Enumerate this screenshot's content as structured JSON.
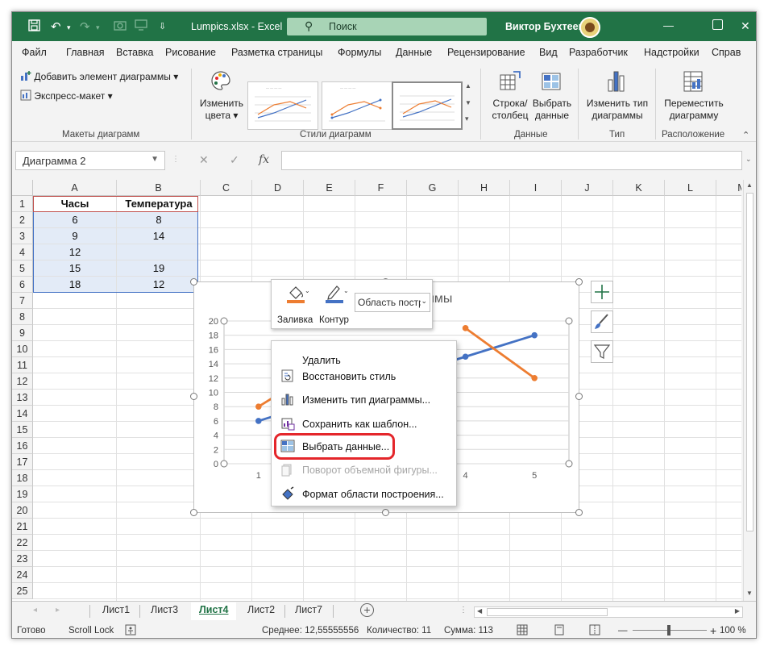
{
  "window": {
    "file_title": "Lumpics.xlsx  -  Excel",
    "search_placeholder": "Поиск",
    "user_name": "Виктор Бухтеев",
    "minimize": "—",
    "close": "✕"
  },
  "ribbon_tabs": [
    "Файл",
    "Главная",
    "Вставка",
    "Рисование",
    "Разметка страницы",
    "Формулы",
    "Данные",
    "Рецензирование",
    "Вид",
    "Разработчик",
    "Надстройки",
    "Справ"
  ],
  "ribbon": {
    "add_element": "Добавить элемент диаграммы",
    "express_layout": "Экспресс-макет",
    "layouts_group": "Макеты диаграмм",
    "change_colors_1": "Изменить",
    "change_colors_2": "цвета",
    "styles_group": "Стили диаграмм",
    "row_col_1": "Строка/",
    "row_col_2": "столбец",
    "select_data_1": "Выбрать",
    "select_data_2": "данные",
    "data_group": "Данные",
    "change_type_1": "Изменить тип",
    "change_type_2": "диаграммы",
    "type_group": "Тип",
    "move_1": "Переместить",
    "move_2": "диаграмму",
    "location_group": "Расположение"
  },
  "formula_bar": {
    "name_box": "Диаграмма 2",
    "cancel": "✕",
    "enter": "✓",
    "fx": "fx",
    "value": ""
  },
  "columns": [
    "A",
    "B",
    "C",
    "D",
    "E",
    "F",
    "G",
    "H",
    "I",
    "J",
    "K",
    "L",
    "M"
  ],
  "rows": [
    "1",
    "2",
    "3",
    "4",
    "5",
    "6",
    "7",
    "8",
    "9",
    "10",
    "11",
    "12",
    "13",
    "14",
    "15",
    "16",
    "17",
    "18",
    "19",
    "20",
    "21",
    "22",
    "23",
    "24",
    "25"
  ],
  "table": {
    "header": [
      "Часы",
      "Температура"
    ],
    "rows": [
      [
        "6",
        "8"
      ],
      [
        "9",
        "14"
      ],
      [
        "12",
        ""
      ],
      [
        "15",
        "19"
      ],
      [
        "18",
        "12"
      ]
    ]
  },
  "mini_toolbar": {
    "fill": "Заливка",
    "outline": "Контур",
    "element_select": "Область постр"
  },
  "context_menu": {
    "items": [
      "Удалить",
      "Восстановить стиль",
      "Изменить тип диаграммы...",
      "Сохранить как шаблон...",
      "Выбрать данные...",
      "Поворот объемной фигуры...",
      "Формат области построения..."
    ]
  },
  "chart_title_fragment": "аммы",
  "chart_data": {
    "type": "line",
    "x": [
      "1",
      "2",
      "3",
      "4",
      "5"
    ],
    "y_ticks": [
      "0",
      "2",
      "4",
      "6",
      "8",
      "10",
      "12",
      "14",
      "16",
      "18",
      "20"
    ],
    "ylim": [
      0,
      20
    ],
    "grid": true,
    "series": [
      {
        "values": [
          6,
          9,
          12,
          15,
          18
        ],
        "color": "#4472c4"
      },
      {
        "values": [
          8,
          14,
          null,
          19,
          12
        ],
        "color": "#ed7d31"
      }
    ]
  },
  "sheet_tabs": [
    "Лист1",
    "Лист3",
    "Лист4",
    "Лист2",
    "Лист7"
  ],
  "active_sheet": "Лист4",
  "status": {
    "ready": "Готово",
    "scroll_lock": "Scroll Lock",
    "average": "Среднее: 12,55555556",
    "count": "Количество: 11",
    "sum": "Сумма: 113",
    "zoom": "100 %"
  },
  "colors": {
    "excel_green": "#217346",
    "selection_fill": "#e3ebf7",
    "highlight_red": "#e4262b"
  }
}
